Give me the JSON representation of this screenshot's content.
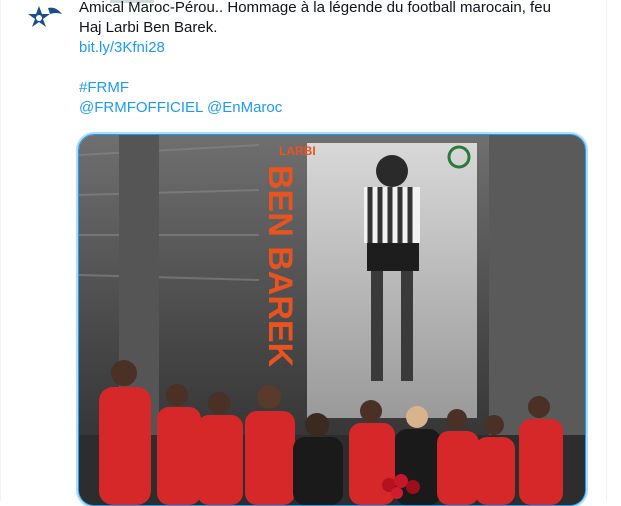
{
  "tweet": {
    "text_line1": "Amical Maroc-Pérou.. Hommage à la légende du football marocain, feu",
    "text_line2": "Haj Larbi Ben Barek.",
    "short_link": "bit.ly/3Kfni28",
    "hashtag": "#FRMF",
    "mention1": "@FRMFOFFICIEL",
    "mention2": "@EnMaroc"
  },
  "media": {
    "banner_small": "LARBI",
    "banner_large": "BEN BAREK"
  },
  "colors": {
    "link": "#1d9bf0",
    "text": "#0f1419",
    "accent_red": "#e8531f",
    "jersey_red": "#d62828"
  },
  "icons": {
    "avatar": "frmf-star-logo"
  }
}
